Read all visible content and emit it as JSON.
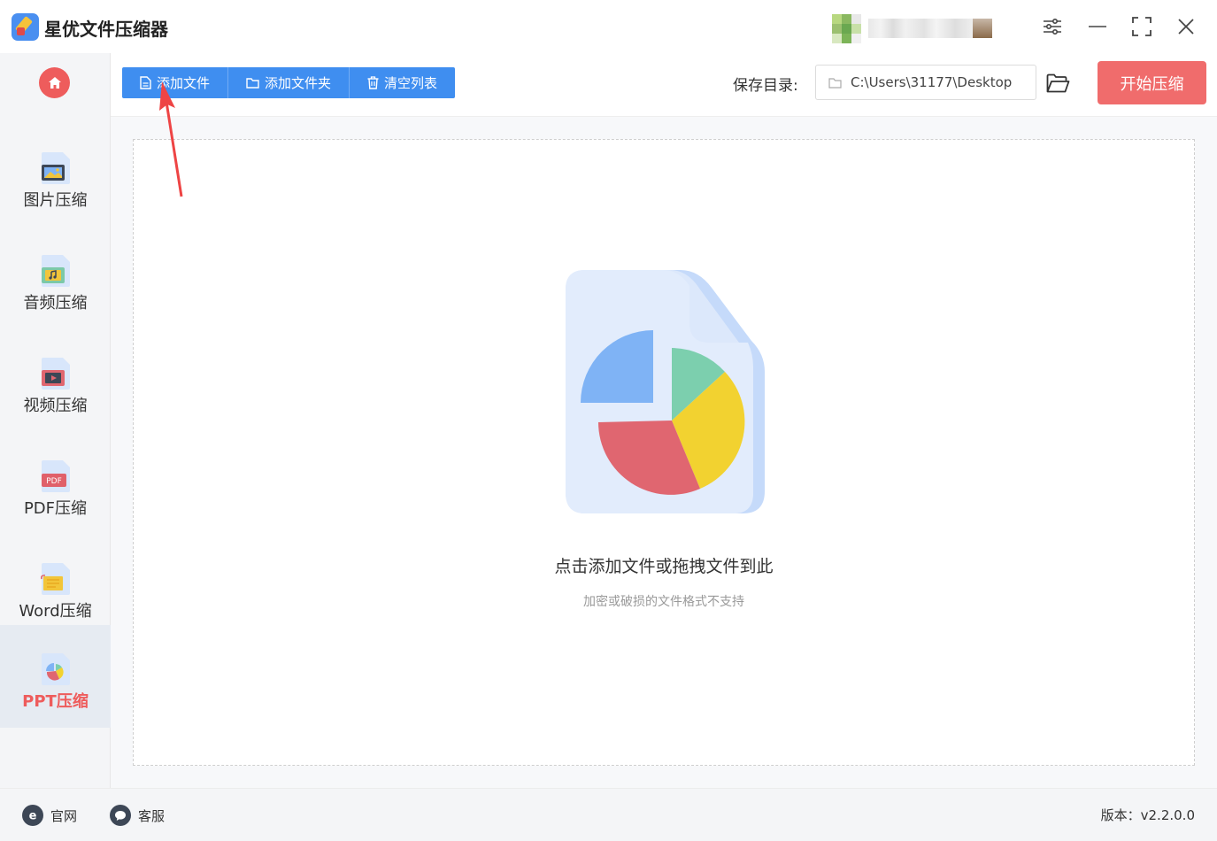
{
  "app": {
    "title": "星优文件压缩器",
    "logo_icon": "app-logo-icon"
  },
  "window": {
    "settings_icon": "sliders-icon",
    "minimize_icon": "minimize-icon",
    "maximize_icon": "maximize-icon",
    "close_icon": "close-icon"
  },
  "sidebar": {
    "home_icon": "home-icon",
    "items": [
      {
        "label": "图片压缩",
        "icon": "image-file-icon",
        "active": false
      },
      {
        "label": "音频压缩",
        "icon": "audio-file-icon",
        "active": false
      },
      {
        "label": "视频压缩",
        "icon": "video-file-icon",
        "active": false
      },
      {
        "label": "PDF压缩",
        "icon": "pdf-file-icon",
        "active": false
      },
      {
        "label": "Word压缩",
        "icon": "word-file-icon",
        "active": false
      },
      {
        "label": "PPT压缩",
        "icon": "ppt-file-icon",
        "active": true
      }
    ]
  },
  "toolbar": {
    "add_file": "添加文件",
    "add_folder": "添加文件夹",
    "clear_list": "清空列表",
    "save_label": "保存目录:",
    "save_path": "C:\\Users\\31177\\Desktop",
    "start": "开始压缩"
  },
  "dropzone": {
    "hint": "点击添加文件或拖拽文件到此",
    "sub": "加密或破损的文件格式不支持",
    "illustration_icon": "pie-chart-document-icon"
  },
  "footer": {
    "website": "官网",
    "support": "客服",
    "version": "版本：v2.2.0.0"
  },
  "colors": {
    "accent_blue": "#3f8ef0",
    "accent_red": "#f06c6c",
    "active_text": "#ee5c5c"
  }
}
